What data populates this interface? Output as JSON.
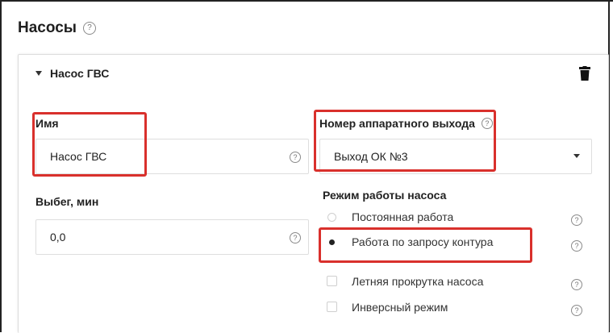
{
  "section": {
    "title": "Насосы"
  },
  "card": {
    "title": "Насос ГВС",
    "icons": {
      "collapse": "caret-down-icon",
      "delete": "trash-icon",
      "help": "question-circle-icon"
    }
  },
  "fields": {
    "name": {
      "label": "Имя",
      "value": "Насос ГВС"
    },
    "output": {
      "label": "Номер аппаратного выхода",
      "value": "Выход ОК №3"
    },
    "runout": {
      "label": "Выбег, мин",
      "value": "0,0"
    }
  },
  "pump_mode": {
    "label": "Режим работы насоса",
    "options": [
      {
        "label": "Постоянная работа",
        "selected": false
      },
      {
        "label": "Работа по запросу контура",
        "selected": true
      }
    ]
  },
  "checkboxes": [
    {
      "label": "Летняя прокрутка насоса",
      "checked": false
    },
    {
      "label": "Инверсный режим",
      "checked": false
    }
  ],
  "colors": {
    "highlight": "#d9302c",
    "border": "#dedede"
  }
}
